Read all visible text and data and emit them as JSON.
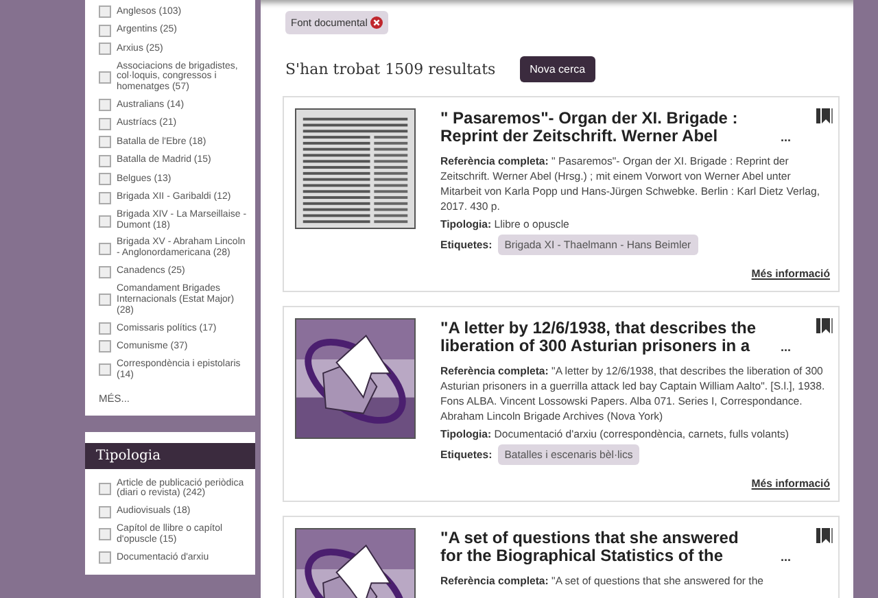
{
  "facets": [
    {
      "items": [
        {
          "label": "Anglesos (103)",
          "checked": false
        },
        {
          "label": "Argentins (25)",
          "checked": false
        },
        {
          "label": "Arxius (25)",
          "checked": false
        },
        {
          "label": "Associacions de brigadistes, col·loquis, congressos i homenatges (57)",
          "checked": false
        },
        {
          "label": "Australians (14)",
          "checked": false
        },
        {
          "label": "Austríacs (21)",
          "checked": false
        },
        {
          "label": "Batalla de l'Ebre (18)",
          "checked": false
        },
        {
          "label": "Batalla de Madrid (15)",
          "checked": false
        },
        {
          "label": "Belgues (13)",
          "checked": false
        },
        {
          "label": "Brigada XII - Garibaldi (12)",
          "checked": false
        },
        {
          "label": "Brigada XIV - La Marseillaise - Dumont (18)",
          "checked": false
        },
        {
          "label": "Brigada XV - Abraham Lincoln - Anglonordamericana (28)",
          "checked": false
        },
        {
          "label": "Canadencs (25)",
          "checked": false
        },
        {
          "label": "Comandament Brigades Internacionals (Estat Major) (28)",
          "checked": false
        },
        {
          "label": "Comissaris polítics (17)",
          "checked": false
        },
        {
          "label": "Comunisme (37)",
          "checked": false
        },
        {
          "label": "Correspondència i epistolaris (14)",
          "checked": false
        }
      ],
      "more": "MÉS..."
    },
    {
      "title": "Tipologia",
      "items": [
        {
          "label": "Article de publicació periòdica (diari o revista) (242)",
          "checked": false
        },
        {
          "label": "Audiovisuals (18)",
          "checked": false
        },
        {
          "label": "Capítol de llibre o capítol d'opuscle (15)",
          "checked": false
        },
        {
          "label": "Documentació d'arxiu",
          "checked": false
        }
      ]
    }
  ],
  "active_filter": {
    "label": "Font documental"
  },
  "results_heading": "S'han trobat 1509 resultats",
  "new_search_button": "Nova cerca",
  "results": [
    {
      "thumbnail": {
        "kind": "scan"
      },
      "title": "\" Pasaremos\"- Organ der XI. Brigade : Reprint der Zeitschrift. Werner Abel",
      "ellipsis": "...",
      "reference_label": "Referència completa:",
      "reference": "\" Pasaremos\"- Organ der XI. Brigade : Reprint der Zeitschrift. Werner Abel (Hrsg.) ; mit einem Vorwort von Werner Abel unter Mitarbeit von Karla Popp und Hans-Jürgen Schwebke. Berlin : Karl Dietz Verlag, 2017. 430 p.",
      "type_label": "Tipologia:",
      "type": "Llibre o opuscle",
      "tags_label": "Etiquetes:",
      "tags": [
        "Brigada XI - Thaelmann - Hans Beimler"
      ],
      "more_link": "Més informació"
    },
    {
      "thumbnail": {
        "kind": "document"
      },
      "title": "\"A letter by 12/6/1938, that describes the liberation of 300 Asturian prisoners in a",
      "ellipsis": "...",
      "reference_label": "Referència completa:",
      "reference": "\"A letter by 12/6/1938, that describes the liberation of 300 Asturian prisoners in a guerrilla attack led bay Captain William Aalto\". [S.l.], 1938. Fons ALBA. Vincent Lossowski Papers. Alba 071. Series I, Correspondance. Abraham Lincoln Brigade Archives (Nova York)",
      "type_label": "Tipologia:",
      "type": "Documentació d'arxiu (correspondència, carnets, fulls volants)",
      "tags_label": "Etiquetes:",
      "tags": [
        "Batalles i escenaris bèl·lics"
      ],
      "more_link": "Més informació"
    },
    {
      "thumbnail": {
        "kind": "document"
      },
      "title": "\"A set of questions that she answered for the Biographical Statistics of the",
      "ellipsis": "...",
      "reference_label": "Referència completa:",
      "reference": "\"A set of questions that she answered for the"
    }
  ]
}
